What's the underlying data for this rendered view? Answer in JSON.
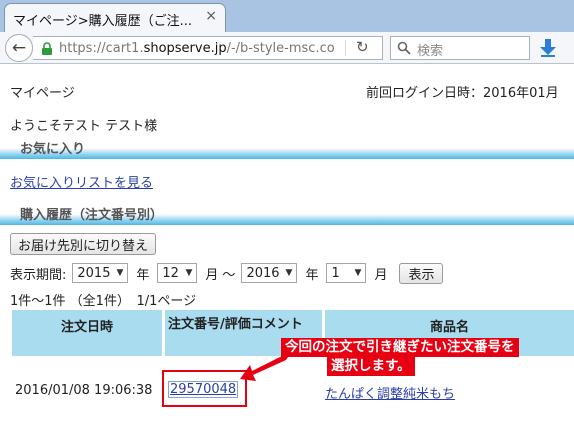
{
  "browser": {
    "tab_title": "マイページ>購入履歴（ご注...",
    "tab_close": "×",
    "url_prefix": "https://cart1.",
    "url_domain": "shopserve.jp",
    "url_suffix": "/-/b-style-msc.co",
    "search_placeholder": "検索"
  },
  "page": {
    "mypage_title": "マイページ",
    "last_login": "前回ログイン日時：2016年01月",
    "welcome": "ようこそテスト テスト様",
    "fav_section": "お気に入り",
    "fav_link": "お気に入りリストを見る",
    "history_section": "購入履歴（注文番号別）",
    "switch_button": "お届け先別に切り替え",
    "period_label": "表示期間:",
    "from_year": "2015",
    "year_unit_1": "年",
    "from_month": "12",
    "month_unit_1": "月",
    "tilde": "～",
    "to_year": "2016",
    "year_unit_2": "年",
    "to_month": "1",
    "month_unit_2": "月",
    "show_button": "表示",
    "count_text": "1件～1件 （全1件）　1/1ページ"
  },
  "table": {
    "headers": {
      "date": "注文日時",
      "order": "注文番号/評価コメント",
      "product": "商品名"
    },
    "rows": [
      {
        "date": "2016/01/08 19:06:38",
        "order_no": "29570048",
        "product": "たんぱく調整純米もち"
      }
    ]
  },
  "annotation": {
    "line1": "今回の注文で引き継ぎたい注文番号を",
    "line2": "選択します。",
    "color": "#e60012"
  }
}
